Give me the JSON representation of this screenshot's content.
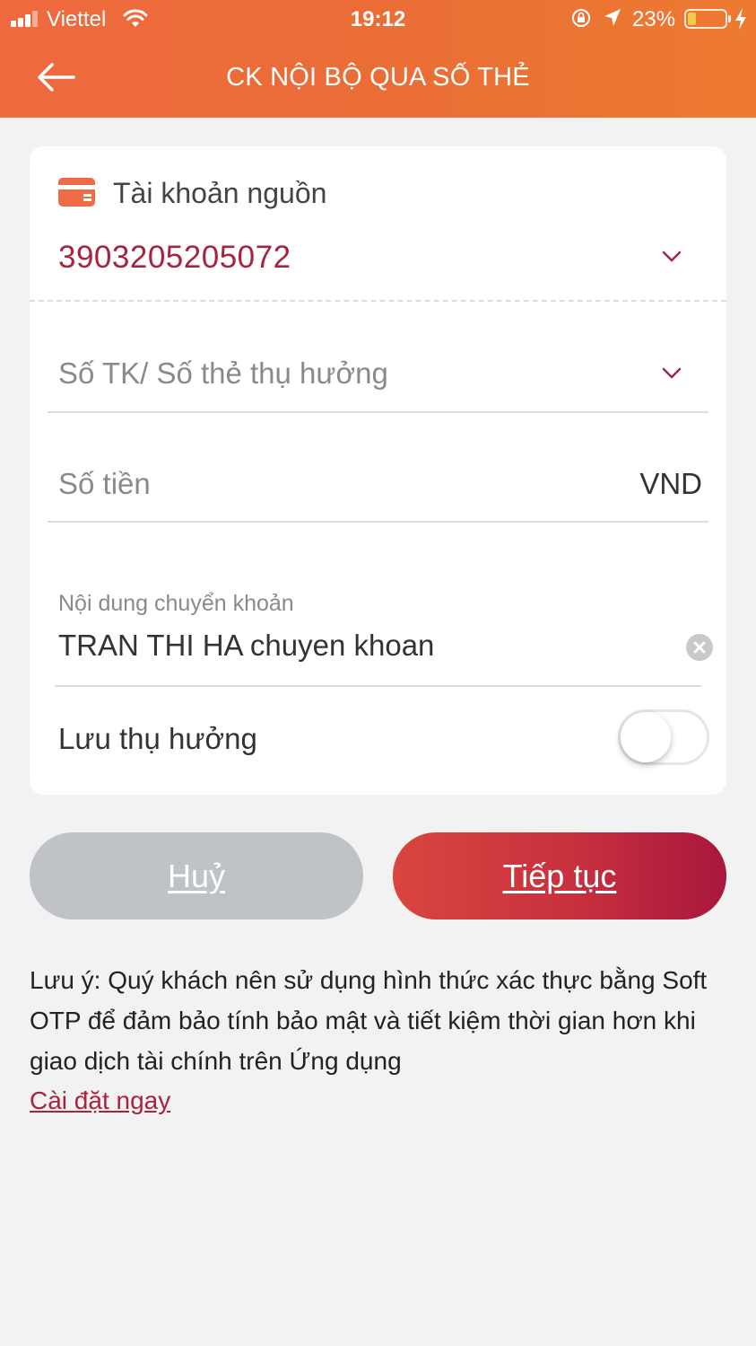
{
  "status_bar": {
    "carrier": "Viettel",
    "time": "19:12",
    "battery_percent": "23%",
    "battery_level": 0.23
  },
  "header": {
    "title": "CK NỘI BỘ QUA SỐ THẺ",
    "background": "#ea6d36"
  },
  "source_account": {
    "label": "Tài khoản nguồn",
    "value": "3903205205072",
    "color": "#a8243e"
  },
  "beneficiary": {
    "placeholder": "Số TK/ Số thẻ thụ hưởng"
  },
  "amount": {
    "placeholder": "Số tiền",
    "currency": "VND"
  },
  "transfer_content": {
    "label": "Nội dung chuyển khoản",
    "value": "TRAN THI HA chuyen khoan"
  },
  "save_beneficiary": {
    "label": "Lưu thụ hưởng",
    "enabled": false
  },
  "buttons": {
    "cancel": "Huỷ",
    "continue": "Tiếp tục"
  },
  "note": {
    "text": "Lưu ý: Quý khách nên sử dụng hình thức xác thực bằng Soft OTP để đảm bảo tính bảo mật và tiết kiệm thời gian hơn khi giao dịch tài chính trên Ứng dụng",
    "link": "Cài đặt ngay"
  }
}
